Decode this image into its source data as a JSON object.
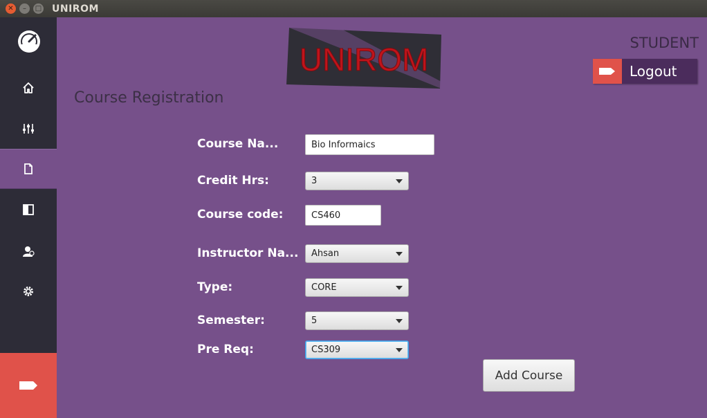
{
  "window": {
    "title": "UNIROM"
  },
  "sidebar": {
    "items": [
      {
        "icon": "gauge-icon"
      },
      {
        "icon": "home-icon"
      },
      {
        "icon": "sliders-icon"
      },
      {
        "icon": "document-icon",
        "active": true
      },
      {
        "icon": "panel-icon"
      },
      {
        "icon": "user-icon"
      },
      {
        "icon": "gear-icon"
      },
      {
        "icon": "exit-tag-icon"
      }
    ]
  },
  "header": {
    "brand": "UNIROM",
    "role": "STUDENT",
    "logout_label": "Logout"
  },
  "page": {
    "title": "Course Registration"
  },
  "form": {
    "course_name_label": "Course Na...",
    "course_name_value": "Bio Informaics",
    "credit_label": "Credit Hrs:",
    "credit_value": "3",
    "code_label": "Course code:",
    "code_value": "CS460",
    "instructor_label": "Instructor Na...",
    "instructor_value": "Ahsan",
    "type_label": "Type:",
    "type_value": "CORE",
    "semester_label": "Semester:",
    "semester_value": "5",
    "prereq_label": "Pre Req:",
    "prereq_value": "CS309",
    "submit_label": "Add Course"
  },
  "colors": {
    "accent": "#76508a",
    "sidebar": "#2d2c37",
    "danger": "#e0524a",
    "brand_red": "#c0141b"
  }
}
